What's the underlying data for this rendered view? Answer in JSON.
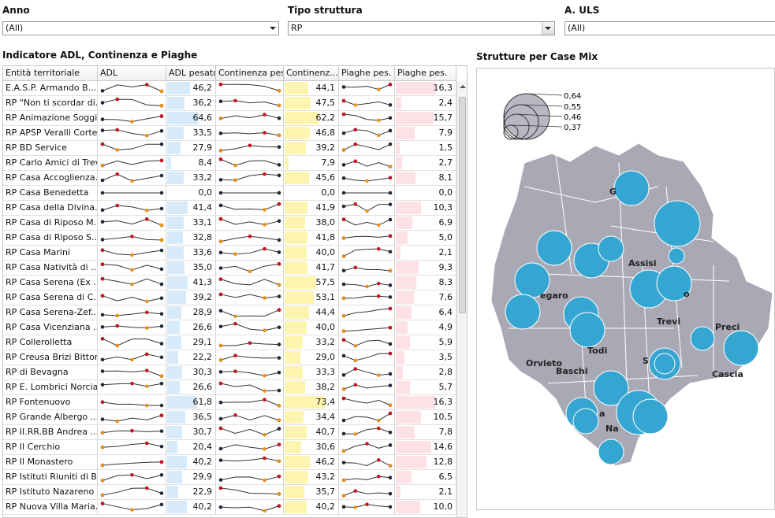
{
  "filters": {
    "anno": {
      "label": "Anno",
      "value": "(All)"
    },
    "tipo": {
      "label": "Tipo struttura",
      "value": "RP"
    },
    "uls": {
      "label": "A. ULS",
      "value": "(All)"
    }
  },
  "table": {
    "title": "Indicatore ADL, Continenza e Piaghe",
    "columns": [
      "Entità territoriale",
      "ADL",
      "ADL pesato",
      "Continenza pes.",
      "Continenz...",
      "Piaghe pes.",
      "Piaghe pes."
    ],
    "colors": {
      "adl": "#d6eafa",
      "cont": "#fdf4b0",
      "piag": "#fde1e5",
      "dot_red": "#c8141e",
      "dot_orange": "#e8901a",
      "dot_dark": "#1e2a3a"
    },
    "rows": [
      {
        "name": "E.A.S.P. Armando B...",
        "adl": "46,2",
        "cont": "44,1",
        "piag": "16,3"
      },
      {
        "name": "RP \"Non ti scordar di...",
        "adl": "36,2",
        "cont": "47,5",
        "piag": "2,4"
      },
      {
        "name": "RP Animazione Soggi...",
        "adl": "64,6",
        "cont": "62,2",
        "piag": "15,7"
      },
      {
        "name": "RP APSP Veralli Cortesi",
        "adl": "33,5",
        "cont": "46,8",
        "piag": "7,9"
      },
      {
        "name": "RP BD Service",
        "adl": "27,9",
        "cont": "39,2",
        "piag": "1,5"
      },
      {
        "name": "RP Carlo Amici di Trevi",
        "adl": "8,4",
        "cont": "7,9",
        "piag": "2,7"
      },
      {
        "name": "RP Casa Accoglienza...",
        "adl": "33,2",
        "cont": "45,6",
        "piag": "8,1"
      },
      {
        "name": "RP Casa Benedetta",
        "adl": "0,0",
        "cont": "0,0",
        "piag": "0,0"
      },
      {
        "name": "RP Casa della Divina...",
        "adl": "41,4",
        "cont": "41,9",
        "piag": "10,3"
      },
      {
        "name": "RP Casa di Riposo M...",
        "adl": "33,1",
        "cont": "38,0",
        "piag": "6,9"
      },
      {
        "name": "RP Casa di Riposo S...",
        "adl": "32,8",
        "cont": "41,8",
        "piag": "5,0"
      },
      {
        "name": "RP Casa Marini",
        "adl": "33,6",
        "cont": "40,0",
        "piag": "2,1"
      },
      {
        "name": "RP Casa Natività di ...",
        "adl": "35,0",
        "cont": "41,7",
        "piag": "9,3"
      },
      {
        "name": "RP Casa Serena (Ex ...",
        "adl": "41,3",
        "cont": "57,5",
        "piag": "8,3"
      },
      {
        "name": "RP Casa Serena di C...",
        "adl": "39,2",
        "cont": "53,1",
        "piag": "7,6"
      },
      {
        "name": "RP Casa Serena-Zef...",
        "adl": "28,9",
        "cont": "44,4",
        "piag": "6,4"
      },
      {
        "name": "RP Casa Vicenziana ...",
        "adl": "26,6",
        "cont": "40,0",
        "piag": "4,9"
      },
      {
        "name": "RP Collerolletta",
        "adl": "29,1",
        "cont": "33,2",
        "piag": "5,9"
      },
      {
        "name": "RP Creusa Brizi Bittoni",
        "adl": "22,2",
        "cont": "29,0",
        "piag": "3,5"
      },
      {
        "name": "RP di Bevagna",
        "adl": "30,3",
        "cont": "33,3",
        "piag": "2,8"
      },
      {
        "name": "RP E. Lombrici Norcia",
        "adl": "26,6",
        "cont": "38,2",
        "piag": "5,7"
      },
      {
        "name": "RP Fontenuovo",
        "adl": "61,8",
        "cont": "73,4",
        "piag": "16,3"
      },
      {
        "name": "RP Grande Albergo ...",
        "adl": "36,5",
        "cont": "34,4",
        "piag": "10,5"
      },
      {
        "name": "RP II.RR.BB Andrea ...",
        "adl": "30,7",
        "cont": "40,7",
        "piag": "7,8"
      },
      {
        "name": "RP Il Cerchio",
        "adl": "20,4",
        "cont": "30,6",
        "piag": "14,6"
      },
      {
        "name": "RP Il Monastero",
        "adl": "40,2",
        "cont": "46,2",
        "piag": "12,8"
      },
      {
        "name": "RP Istituti Riuniti di B...",
        "adl": "29,9",
        "cont": "43,2",
        "piag": "6,5"
      },
      {
        "name": "RP Istituto Nazareno",
        "adl": "22,9",
        "cont": "35,7",
        "piag": "2,1"
      },
      {
        "name": "RP Nuova Villa Maria...",
        "adl": "40,2",
        "cont": "40,2",
        "piag": "10,0"
      }
    ]
  },
  "map": {
    "title": "Strutture per Case Mix",
    "legend": [
      "0,64",
      "0,55",
      "0,46",
      "0,37"
    ],
    "land_color": "#a9a9b6",
    "bubble_color": "#35a6d2",
    "labels": [
      "G",
      "Assisi",
      "o",
      "egaro",
      "Trevi",
      "Preci",
      "Todi",
      "Orvieto",
      "Baschi",
      "S",
      "Cascia",
      "a",
      "Na"
    ]
  }
}
